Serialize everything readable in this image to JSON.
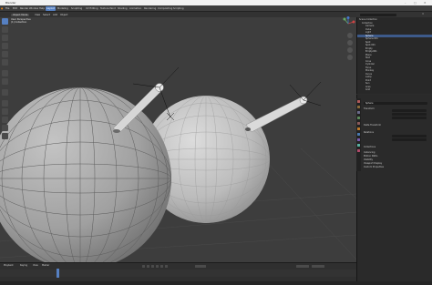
{
  "window": {
    "title": "Blender"
  },
  "topbar": {
    "menus": [
      "File",
      "Edit",
      "Render",
      "Window",
      "Help"
    ],
    "workspaces": [
      "Layout",
      "Modeling",
      "Sculpting",
      "UV Editing",
      "Texture Paint",
      "Shading",
      "Animation",
      "Rendering",
      "Compositing",
      "Scripting"
    ],
    "active_workspace": "Layout"
  },
  "viewport": {
    "mode": "Object Mode",
    "menus": [
      "View",
      "Select",
      "Add",
      "Object"
    ],
    "overlay_lines": [
      "User Perspective",
      "(1) Collection"
    ]
  },
  "outliner": {
    "rows": [
      "Scene Collection",
      "Collection",
      "Camera",
      "Cube",
      "Light",
      "Sphere",
      "Sphere.001",
      "Spot",
      "Spot.001",
      "Empty",
      "Empty.001",
      "Plane",
      "Text",
      "Cone",
      "Cylinder",
      "Torus",
      "Monkey",
      "Curve",
      "Lamp",
      "Point",
      "Sun",
      "Area",
      "Grid"
    ],
    "selected_index": 5
  },
  "properties": {
    "object_name": "Sphere",
    "sections": [
      "Transform",
      "Delta Transform",
      "Relations",
      "Collections",
      "Instancing",
      "Motion Paths",
      "Visibility",
      "Viewport Display",
      "Custom Properties"
    ]
  },
  "timeline": {
    "menus": [
      "Playback",
      "Keying",
      "View",
      "Marker"
    ]
  },
  "colors": {
    "accent": "#5680c2",
    "sphere": "#a8a8a8",
    "light_gizmo": "#d8d8d8"
  }
}
